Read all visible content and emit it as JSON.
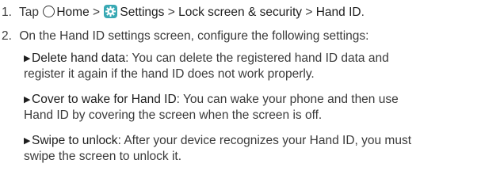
{
  "steps": [
    {
      "number": "1.",
      "parts": {
        "tap": "Tap",
        "home": "Home",
        "sep1": ">",
        "settings": "Settings",
        "sep2": ">",
        "lock": "Lock screen & security",
        "sep3": ">",
        "handid": "Hand ID",
        "end": "."
      }
    },
    {
      "number": "2.",
      "text": "On the Hand ID settings screen, configure the following settings:"
    }
  ],
  "bullets": [
    {
      "term": "Delete hand data",
      "line1": ": You can delete the registered hand ID data and",
      "line2": "register it again if the hand ID does not work properly."
    },
    {
      "term": "Cover to wake for Hand ID",
      "line1": ": You can wake your phone and then use",
      "line2": "Hand ID by covering the screen when the screen is off."
    },
    {
      "term": "Swipe to unlock",
      "line1": ": After your device recognizes your Hand ID, you must",
      "line2": "swipe the screen to unlock it."
    }
  ],
  "icons": {
    "home": "home-circle-icon",
    "settings": "settings-gear-icon",
    "bullet": "triangle-right-icon",
    "settings_color": "#39a9b4"
  }
}
